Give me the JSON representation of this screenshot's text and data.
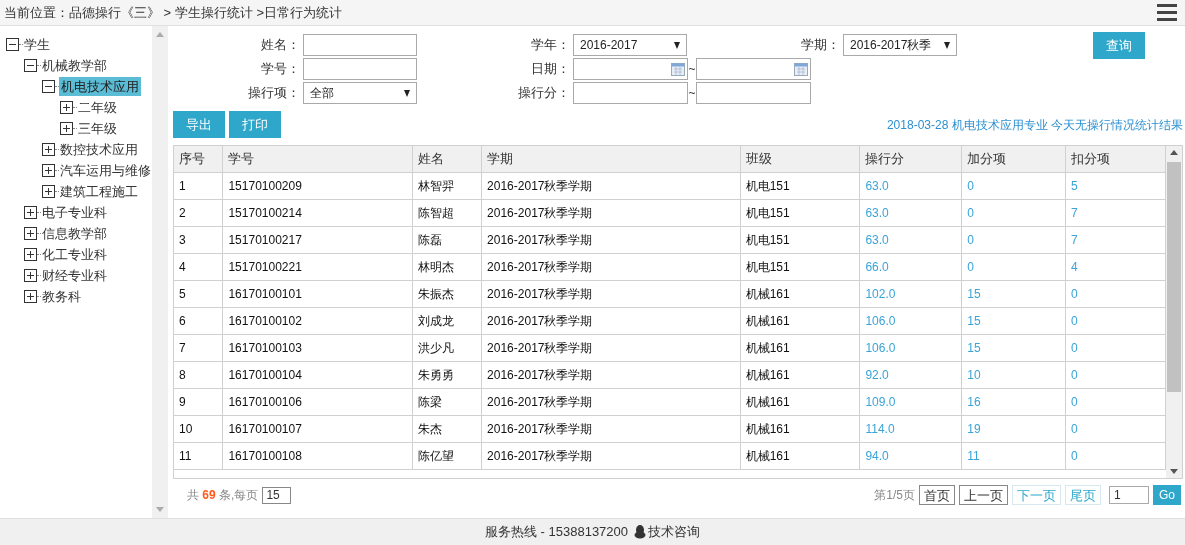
{
  "breadcrumb": "当前位置：品德操行《三》 > 学生操行统计 >日常行为统计",
  "tree": [
    {
      "label": "学生",
      "expanded": true,
      "selected": false,
      "children": [
        {
          "label": "机械教学部",
          "expanded": true,
          "selected": false,
          "children": [
            {
              "label": "机电技术应用",
              "expanded": true,
              "selected": true,
              "children": [
                {
                  "label": "二年级",
                  "expanded": false,
                  "selected": false
                },
                {
                  "label": "三年级",
                  "expanded": false,
                  "selected": false
                }
              ]
            },
            {
              "label": "数控技术应用",
              "expanded": false,
              "selected": false
            },
            {
              "label": "汽车运用与维修",
              "expanded": false,
              "selected": false
            },
            {
              "label": "建筑工程施工",
              "expanded": false,
              "selected": false
            }
          ]
        },
        {
          "label": "电子专业科",
          "expanded": false,
          "selected": false
        },
        {
          "label": "信息教学部",
          "expanded": false,
          "selected": false
        },
        {
          "label": "化工专业科",
          "expanded": false,
          "selected": false
        },
        {
          "label": "财经专业科",
          "expanded": false,
          "selected": false
        },
        {
          "label": "教务科",
          "expanded": false,
          "selected": false
        }
      ]
    }
  ],
  "filter_rows": [
    [
      {
        "label": "姓名：",
        "kind": "text"
      },
      {
        "label": "学年：",
        "kind": "select",
        "value": "2016-2017"
      },
      {
        "label": "学期：",
        "kind": "select",
        "value": "2016-2017秋季"
      }
    ],
    [
      {
        "label": "学号：",
        "kind": "text"
      },
      {
        "label": "日期：",
        "kind": "date_range",
        "separator": "~"
      }
    ],
    [
      {
        "label": "操行项：",
        "kind": "select",
        "value": "全部"
      },
      {
        "label": "操行分：",
        "kind": "range",
        "separator": "~"
      }
    ]
  ],
  "search_button": "查询",
  "action_buttons": [
    "导出",
    "打印"
  ],
  "result_note": "2018-03-28  机电技术应用专业 今天无操行情况统计结果",
  "table": {
    "columns": [
      {
        "label": "序号",
        "kind": "text"
      },
      {
        "label": "学号",
        "kind": "text"
      },
      {
        "label": "姓名",
        "kind": "text"
      },
      {
        "label": "学期",
        "kind": "text"
      },
      {
        "label": "班级",
        "kind": "text"
      },
      {
        "label": "操行分",
        "kind": "link"
      },
      {
        "label": "加分项",
        "kind": "link"
      },
      {
        "label": "扣分项",
        "kind": "link"
      }
    ],
    "rows": [
      [
        "1",
        "15170100209",
        "林智羿",
        "2016-2017秋季学期",
        "机电151",
        "63.0",
        "0",
        "5"
      ],
      [
        "2",
        "15170100214",
        "陈智超",
        "2016-2017秋季学期",
        "机电151",
        "63.0",
        "0",
        "7"
      ],
      [
        "3",
        "15170100217",
        "陈磊",
        "2016-2017秋季学期",
        "机电151",
        "63.0",
        "0",
        "7"
      ],
      [
        "4",
        "15170100221",
        "林明杰",
        "2016-2017秋季学期",
        "机电151",
        "66.0",
        "0",
        "4"
      ],
      [
        "5",
        "16170100101",
        "朱振杰",
        "2016-2017秋季学期",
        "机械161",
        "102.0",
        "15",
        "0"
      ],
      [
        "6",
        "16170100102",
        "刘成龙",
        "2016-2017秋季学期",
        "机械161",
        "106.0",
        "15",
        "0"
      ],
      [
        "7",
        "16170100103",
        "洪少凡",
        "2016-2017秋季学期",
        "机械161",
        "106.0",
        "15",
        "0"
      ],
      [
        "8",
        "16170100104",
        "朱勇勇",
        "2016-2017秋季学期",
        "机械161",
        "92.0",
        "10",
        "0"
      ],
      [
        "9",
        "16170100106",
        "陈梁",
        "2016-2017秋季学期",
        "机械161",
        "109.0",
        "16",
        "0"
      ],
      [
        "10",
        "16170100107",
        "朱杰",
        "2016-2017秋季学期",
        "机械161",
        "114.0",
        "19",
        "0"
      ],
      [
        "11",
        "16170100108",
        "陈亿望",
        "2016-2017秋季学期",
        "机械161",
        "94.0",
        "11",
        "0"
      ]
    ]
  },
  "pager": {
    "total": "共 **69** 条,每页",
    "page_size": "15",
    "page_info": "第1/5页",
    "buttons": [
      {
        "label": "首页",
        "disabled": true
      },
      {
        "label": "上一页",
        "disabled": true
      },
      {
        "label": "下一页",
        "disabled": false
      },
      {
        "label": "尾页",
        "disabled": false
      }
    ],
    "page_input": "1",
    "go": "Go"
  },
  "footer": {
    "hotline": "服务热线 - 15388137200",
    "consult": "技术咨询"
  }
}
